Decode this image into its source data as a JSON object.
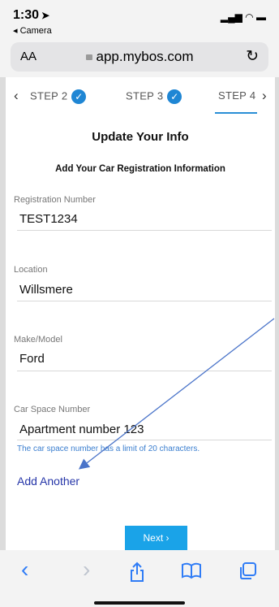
{
  "status": {
    "time": "1:30",
    "back_app": "◂ Camera",
    "signal": "▂▄▆ ◠ ▬"
  },
  "browser": {
    "aa_label": "AA",
    "url": "app.mybos.com",
    "reload_icon": "reload-icon"
  },
  "steps": {
    "prev": "‹",
    "next": "›",
    "items": [
      {
        "label": "STEP 2",
        "done": true
      },
      {
        "label": "STEP 3",
        "done": true
      },
      {
        "label": "STEP 4",
        "done": false
      }
    ]
  },
  "form": {
    "title": "Update Your Info",
    "subtitle": "Add Your Car Registration Information",
    "fields": [
      {
        "label": "Registration Number",
        "value": "TEST1234"
      },
      {
        "label": "Location",
        "value": "Willsmere"
      },
      {
        "label": "Make/Model",
        "value": "Ford"
      },
      {
        "label": "Car Space Number",
        "value": "Apartment number 123"
      }
    ],
    "hint": "The car space number has a limit of 20 characters.",
    "add_another": "Add Another",
    "next_button": "Next"
  },
  "toolbar": {
    "back": "‹",
    "forward": "›",
    "icons": [
      "back-icon",
      "forward-icon",
      "share-icon",
      "bookmarks-icon",
      "tabs-icon"
    ]
  },
  "colors": {
    "accent": "#1f86d4",
    "next_button": "#1aa3e8",
    "link": "#2535a8",
    "hint": "#3a7ecf"
  }
}
